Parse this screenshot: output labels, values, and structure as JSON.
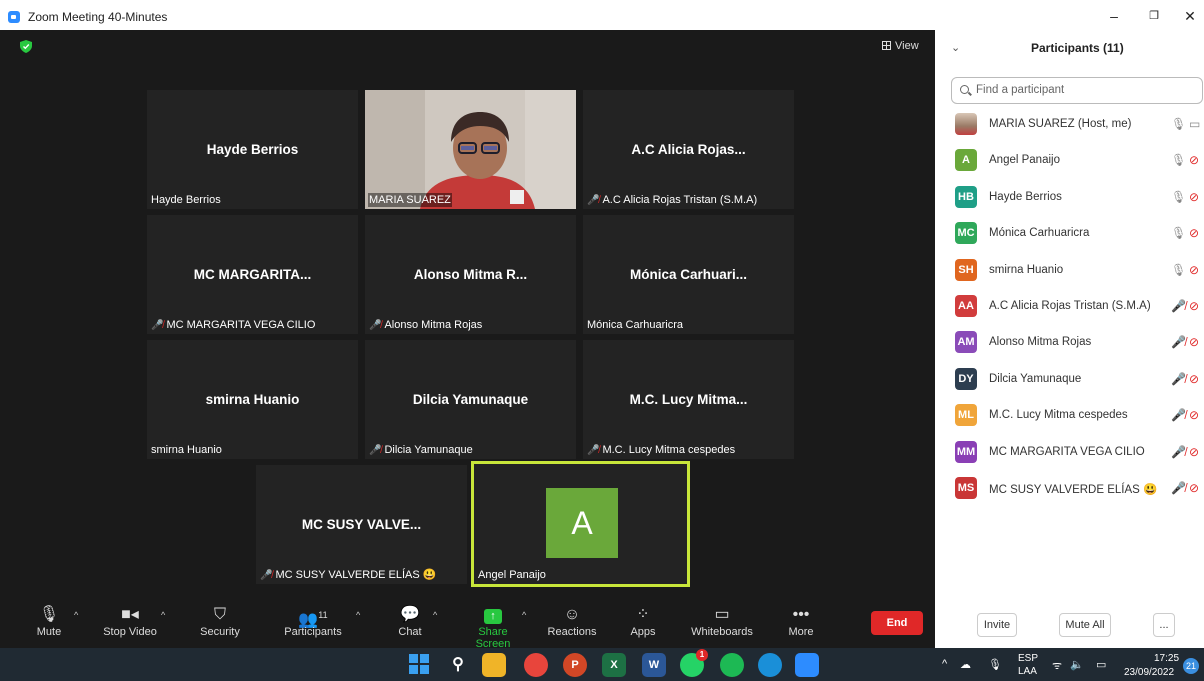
{
  "window": {
    "title": "Zoom Meeting 40-Minutes",
    "minimize": "–",
    "restore": "❐",
    "close": "✕"
  },
  "meeting": {
    "view_label": "View",
    "tiles": [
      {
        "big": "Hayde Berrios",
        "label": "Hayde Berrios",
        "muted": false
      },
      {
        "big": "",
        "label": "MARIA SUAREZ",
        "muted": false,
        "video": true
      },
      {
        "big": "A.C Alicia Rojas...",
        "label": "A.C Alicia Rojas Tristan (S.M.A)",
        "muted": true
      },
      {
        "big": "MC  MARGARITA...",
        "label": "MC MARGARITA VEGA CILIO",
        "muted": true
      },
      {
        "big": "Alonso Mitma R...",
        "label": "Alonso Mitma Rojas",
        "muted": true
      },
      {
        "big": "Mónica Carhuari...",
        "label": "Mónica Carhuaricra",
        "muted": false
      },
      {
        "big": "smirna Huanio",
        "label": "smirna Huanio",
        "muted": false
      },
      {
        "big": "Dilcia Yamunaque",
        "label": "Dilcia Yamunaque",
        "muted": true
      },
      {
        "big": "M.C. Lucy Mitma...",
        "label": "M.C. Lucy Mitma cespedes",
        "muted": true
      },
      {
        "big": "MC SUSY VALVE...",
        "label": "MC SUSY VALVERDE ELÍAS 😃",
        "muted": true
      },
      {
        "big": "",
        "label": "Angel Panaijo",
        "muted": false,
        "active": true,
        "avatar": "A"
      }
    ]
  },
  "toolbar": {
    "mute": "Mute",
    "stop_video": "Stop Video",
    "security": "Security",
    "participants": "Participants",
    "participants_count": "11",
    "chat": "Chat",
    "share_screen": "Share Screen",
    "reactions": "Reactions",
    "apps": "Apps",
    "whiteboards": "Whiteboards",
    "more": "More",
    "end": "End"
  },
  "panel": {
    "title": "Participants (11)",
    "search_placeholder": "Find a participant",
    "invite": "Invite",
    "mute_all": "Mute All",
    "more": "...",
    "participants": [
      {
        "initials": "",
        "name": "MARIA SUAREZ (Host, me)",
        "color": "#b59a86",
        "mic_muted": false,
        "cam_on": true
      },
      {
        "initials": "A",
        "name": "Angel Panaijo",
        "color": "#6aa83a",
        "mic_muted": false,
        "cam_on": false
      },
      {
        "initials": "HB",
        "name": "Hayde Berrios",
        "color": "#1f9f87",
        "mic_muted": false,
        "cam_on": false
      },
      {
        "initials": "MC",
        "name": "Mónica Carhuaricra",
        "color": "#2fa85a",
        "mic_muted": false,
        "cam_on": false
      },
      {
        "initials": "SH",
        "name": "smirna Huanio",
        "color": "#e0661f",
        "mic_muted": false,
        "cam_on": false
      },
      {
        "initials": "AA",
        "name": "A.C Alicia Rojas Tristan (S.M.A)",
        "color": "#d13c3c",
        "mic_muted": true,
        "cam_on": false
      },
      {
        "initials": "AM",
        "name": "Alonso Mitma Rojas",
        "color": "#8a4bb8",
        "mic_muted": true,
        "cam_on": false
      },
      {
        "initials": "DY",
        "name": "Dilcia Yamunaque",
        "color": "#2d3e50",
        "mic_muted": true,
        "cam_on": false
      },
      {
        "initials": "ML",
        "name": "M.C. Lucy Mitma cespedes",
        "color": "#f0a53a",
        "mic_muted": true,
        "cam_on": false
      },
      {
        "initials": "MM",
        "name": "MC MARGARITA VEGA CILIO",
        "color": "#8a3fb5",
        "mic_muted": true,
        "cam_on": false
      },
      {
        "initials": "MS",
        "name": "MC SUSY VALVERDE ELÍAS 😃",
        "color": "#c93636",
        "mic_muted": true,
        "cam_on": false
      }
    ]
  },
  "taskbar": {
    "lang_top": "ESP",
    "lang_bottom": "LAA",
    "time": "17:25",
    "date": "23/09/2022",
    "notifications": "21",
    "whatsapp_badge": "1"
  }
}
